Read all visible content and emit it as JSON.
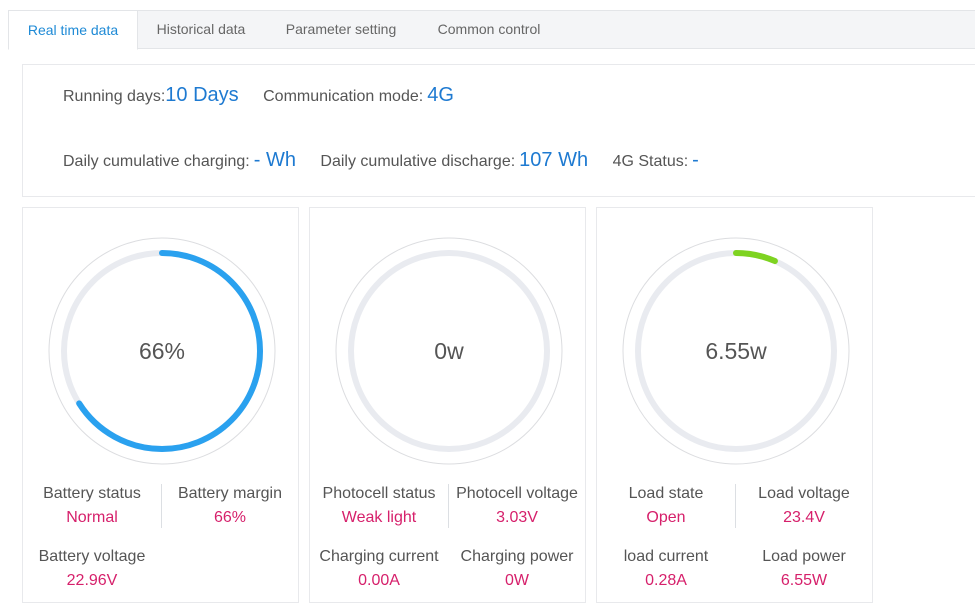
{
  "tabs": [
    {
      "label": "Real time data",
      "active": true
    },
    {
      "label": "Historical data",
      "active": false
    },
    {
      "label": "Parameter setting",
      "active": false
    },
    {
      "label": "Common control",
      "active": false
    }
  ],
  "info": {
    "running_days_label": "Running days:",
    "running_days_value": "10 Days",
    "comm_mode_label": "Communication mode:",
    "comm_mode_value": "4G",
    "daily_charging_label": "Daily cumulative charging:",
    "daily_charging_value": "- Wh",
    "daily_discharge_label": "Daily cumulative discharge:",
    "daily_discharge_value": "107 Wh",
    "status_4g_label": "4G Status:",
    "status_4g_value": "-"
  },
  "cards": [
    {
      "gauge_text": "66%",
      "gauge_fraction": 0.66,
      "gauge_color": "#2aa1ef",
      "top_left": {
        "label": "Battery status",
        "value": "Normal"
      },
      "top_right": {
        "label": "Battery margin",
        "value": "66%"
      },
      "bottom_left": {
        "label": "Battery voltage",
        "value": "22.96V"
      },
      "bottom_right": {
        "label": "",
        "value": ""
      }
    },
    {
      "gauge_text": "0w",
      "gauge_fraction": 0,
      "gauge_color": "#2aa1ef",
      "top_left": {
        "label": "Photocell status",
        "value": "Weak light"
      },
      "top_right": {
        "label": "Photocell voltage",
        "value": "3.03V"
      },
      "bottom_left": {
        "label": "Charging current",
        "value": "0.00A"
      },
      "bottom_right": {
        "label": "Charging power",
        "value": "0W"
      }
    },
    {
      "gauge_text": "6.55w",
      "gauge_fraction": 0.065,
      "gauge_color": "#7ed321",
      "top_left": {
        "label": "Load state",
        "value": "Open"
      },
      "top_right": {
        "label": "Load voltage",
        "value": "23.4V"
      },
      "bottom_left": {
        "label": "load current",
        "value": "0.28A"
      },
      "bottom_right": {
        "label": "Load power",
        "value": "6.55W"
      }
    }
  ],
  "colors": {
    "accent": "#1e7ad1",
    "value_pink": "#d6206b",
    "track": "#e9ebf0"
  }
}
